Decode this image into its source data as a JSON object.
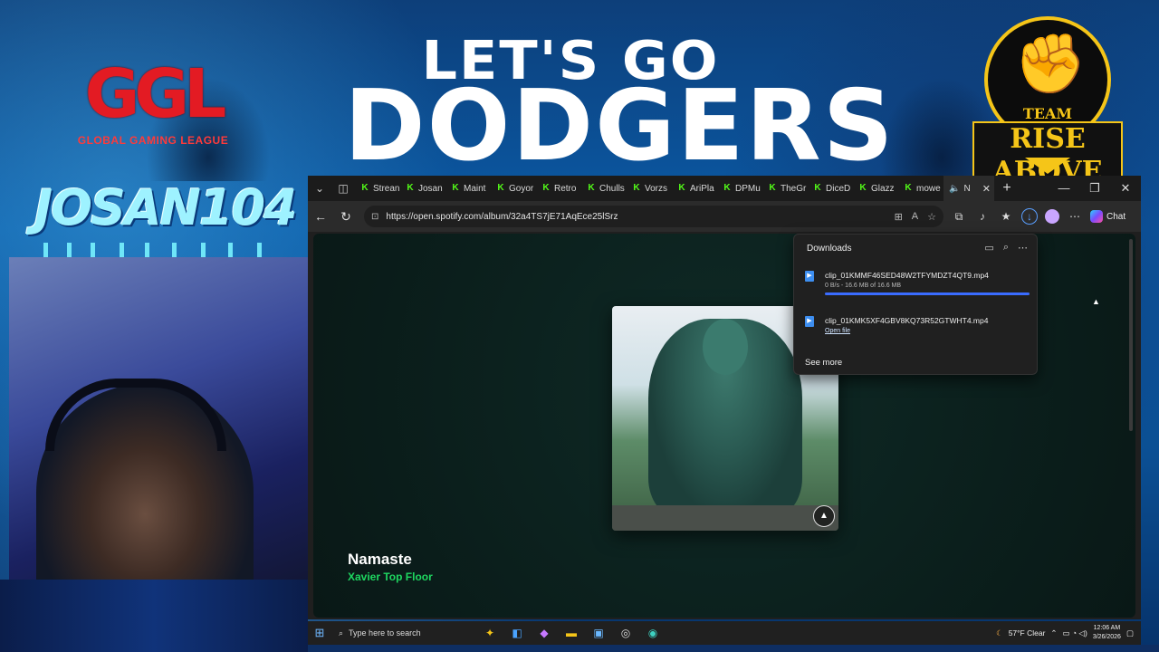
{
  "overlay": {
    "headline_line1": "LET'S GO",
    "headline_line2": "DODGERS",
    "ggl_logo_text": "GGL",
    "ggl_subtitle": "GLOBAL GAMING LEAGUE",
    "graffiti_name": "JOSAN104",
    "badge_team": "TEAM",
    "badge_name": "RISE ABOVE"
  },
  "browser": {
    "tabs": [
      {
        "label": "Strean",
        "favicon": "K"
      },
      {
        "label": "Josan",
        "favicon": "K"
      },
      {
        "label": "Maint",
        "favicon": "K"
      },
      {
        "label": "Goyor",
        "favicon": "K"
      },
      {
        "label": "Retro",
        "favicon": "K"
      },
      {
        "label": "Chulls",
        "favicon": "K"
      },
      {
        "label": "Vorzs",
        "favicon": "K"
      },
      {
        "label": "AriPla",
        "favicon": "K"
      },
      {
        "label": "DPMu",
        "favicon": "K"
      },
      {
        "label": "TheGr",
        "favicon": "K"
      },
      {
        "label": "DiceD",
        "favicon": "K"
      },
      {
        "label": "Glazz",
        "favicon": "K"
      },
      {
        "label": "mowe",
        "favicon": "K"
      }
    ],
    "active_tab": {
      "label": "N",
      "close": "✕"
    },
    "new_tab": "+",
    "window_controls": {
      "minimize": "—",
      "restore": "❐",
      "close": "✕"
    },
    "url": "https://open.spotify.com/album/32a4TS7jE71AqEce25lSrz",
    "chat_label": "Chat"
  },
  "downloads": {
    "title": "Downloads",
    "items": [
      {
        "name": "clip_01KMMF46SED48W2TFYMDZT4QT9.mp4",
        "status": "0 B/s - 16.6 MB of 16.6 MB",
        "progress_pct": 100
      },
      {
        "name": "clip_01KMK5XF4GBV8KQ73R52GTWHT4.mp4",
        "action": "Open file"
      }
    ],
    "see_more": "See more"
  },
  "player": {
    "track_title": "Namaste",
    "artist": "Xavier Top Floor"
  },
  "taskbar": {
    "search_placeholder": "Type here to search",
    "weather": "57°F  Clear",
    "time": "12:06 AM",
    "date": "3/26/2026"
  },
  "colors": {
    "spotify_green": "#1ed760",
    "kick_green": "#53fc18",
    "download_accent": "#3a6cff",
    "badge_gold": "#f5c518",
    "ggl_red": "#e31b23"
  }
}
